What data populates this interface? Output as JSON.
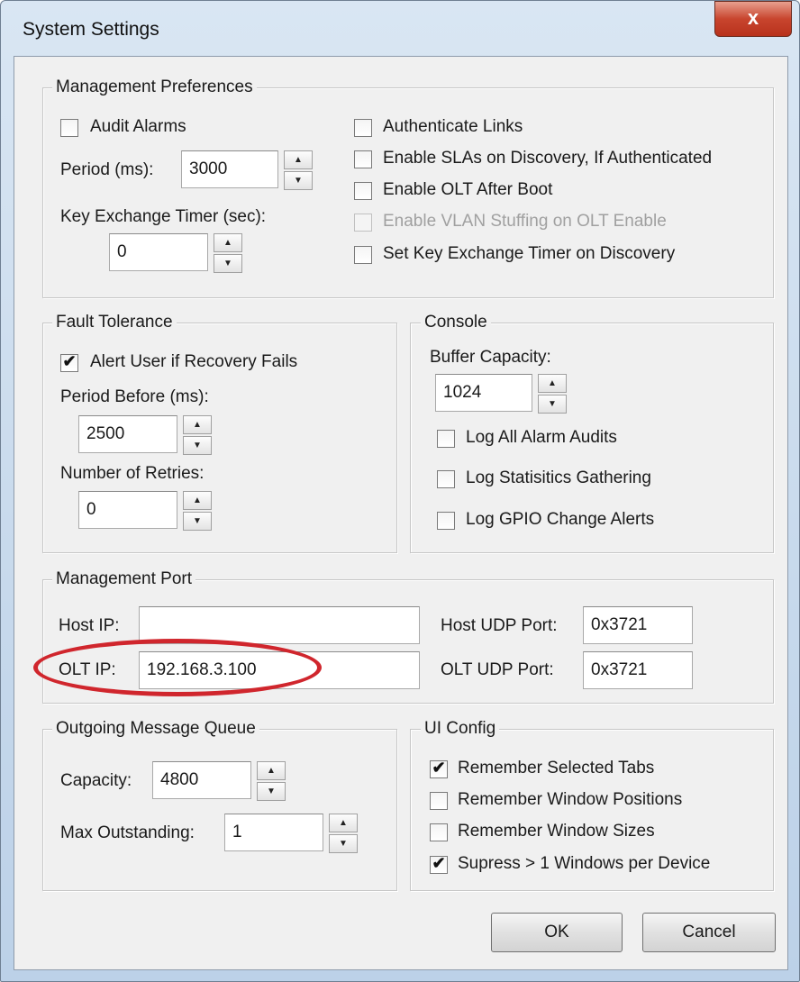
{
  "window": {
    "title": "System Settings",
    "close_glyph": "x"
  },
  "management_preferences": {
    "legend": "Management Preferences",
    "audit_alarms": {
      "label": "Audit Alarms",
      "checked": false
    },
    "period_label": "Period (ms):",
    "period_value": "3000",
    "key_exchange_label": "Key Exchange Timer (sec):",
    "key_exchange_value": "0",
    "authenticate_links": {
      "label": "Authenticate Links",
      "checked": false
    },
    "enable_slas": {
      "label": "Enable SLAs on Discovery, If Authenticated",
      "checked": false
    },
    "enable_olt_after_boot": {
      "label": "Enable OLT After Boot",
      "checked": false
    },
    "enable_vlan_stuffing": {
      "label": "Enable VLAN Stuffing on OLT Enable",
      "checked": false,
      "disabled": true
    },
    "set_key_exchange_timer": {
      "label": "Set Key Exchange Timer on Discovery",
      "checked": false
    }
  },
  "fault_tolerance": {
    "legend": "Fault Tolerance",
    "alert_user": {
      "label": "Alert User if Recovery Fails",
      "checked": true
    },
    "period_before_label": "Period Before (ms):",
    "period_before_value": "2500",
    "retries_label": "Number of Retries:",
    "retries_value": "0"
  },
  "console": {
    "legend": "Console",
    "buffer_capacity_label": "Buffer Capacity:",
    "buffer_capacity_value": "1024",
    "log_alarm_audits": {
      "label": "Log All Alarm Audits",
      "checked": false
    },
    "log_statistics": {
      "label": "Log Statisitics Gathering",
      "checked": false
    },
    "log_gpio": {
      "label": "Log GPIO Change Alerts",
      "checked": false
    }
  },
  "management_port": {
    "legend": "Management Port",
    "host_ip_label": "Host IP:",
    "host_ip_value": "",
    "olt_ip_label": "OLT IP:",
    "olt_ip_value": "192.168.3.100",
    "host_udp_label": "Host UDP Port:",
    "host_udp_value": "0x3721",
    "olt_udp_label": "OLT UDP Port:",
    "olt_udp_value": "0x3721",
    "highlight_color": "#d0262d"
  },
  "outgoing_queue": {
    "legend": "Outgoing Message Queue",
    "capacity_label": "Capacity:",
    "capacity_value": "4800",
    "max_outstanding_label": "Max Outstanding:",
    "max_outstanding_value": "1"
  },
  "ui_config": {
    "legend": "UI Config",
    "remember_tabs": {
      "label": "Remember Selected Tabs",
      "checked": true
    },
    "remember_positions": {
      "label": "Remember Window Positions",
      "checked": false
    },
    "remember_sizes": {
      "label": "Remember Window Sizes",
      "checked": false
    },
    "supress_windows": {
      "label": "Supress > 1 Windows per Device",
      "checked": true
    }
  },
  "buttons": {
    "ok": "OK",
    "cancel": "Cancel"
  },
  "spin": {
    "up_glyph": "▲",
    "down_glyph": "▼"
  },
  "check_glyph": "✔"
}
